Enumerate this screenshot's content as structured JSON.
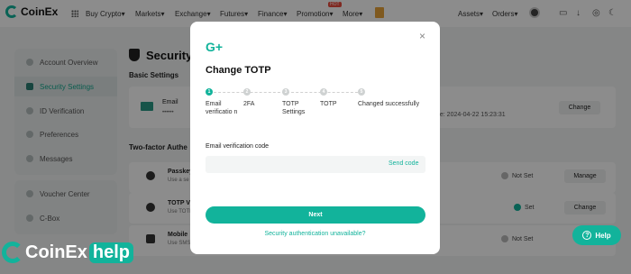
{
  "topnav": {
    "logo": "CoinEx",
    "items": [
      "Buy Crypto",
      "Markets",
      "Exchange",
      "Futures",
      "Finance",
      "Promotion",
      "More"
    ],
    "hot_badge": "HOT",
    "assets": "Assets",
    "orders": "Orders"
  },
  "sidebar": {
    "items": [
      "Account Overview",
      "Security Settings",
      "ID Verification",
      "Preferences",
      "Messages"
    ],
    "items2": [
      "Voucher Center",
      "C-Box"
    ]
  },
  "main": {
    "title": "Security",
    "basic_title": "Basic Settings",
    "email_label": "Email",
    "email_mask": "••••••",
    "last_change": "ge: 2024-04-22 15:23:31",
    "change_label": "Change",
    "tfa_title": "Two-factor Authe",
    "rows": [
      {
        "title": "Passkey",
        "sub": "Use a se",
        "status": "Not Set",
        "action": "Manage"
      },
      {
        "title": "TOTP V",
        "sub": "Use TOTP",
        "status": "Set",
        "action": "Change"
      },
      {
        "title": "Mobile",
        "sub": "Use SMS",
        "status": "Not Set",
        "action": "Set"
      }
    ]
  },
  "modal": {
    "logo": "G+",
    "close": "×",
    "title": "Change TOTP",
    "steps": [
      {
        "num": "1",
        "label": "Email verificatio n"
      },
      {
        "num": "2",
        "label": "2FA"
      },
      {
        "num": "3",
        "label": "TOTP Settings"
      },
      {
        "num": "4",
        "label": "TOTP"
      },
      {
        "num": "5",
        "label": "Changed successfully"
      }
    ],
    "field_label": "Email verification code",
    "input_placeholder": "",
    "send_code": "Send code",
    "next": "Next",
    "unavailable": "Security authentication unavailable?"
  },
  "help": {
    "label": "Help",
    "q": "?"
  },
  "watermark": {
    "brand": "CoinEx",
    "help": "help"
  },
  "colors": {
    "accent": "#12b39b"
  }
}
